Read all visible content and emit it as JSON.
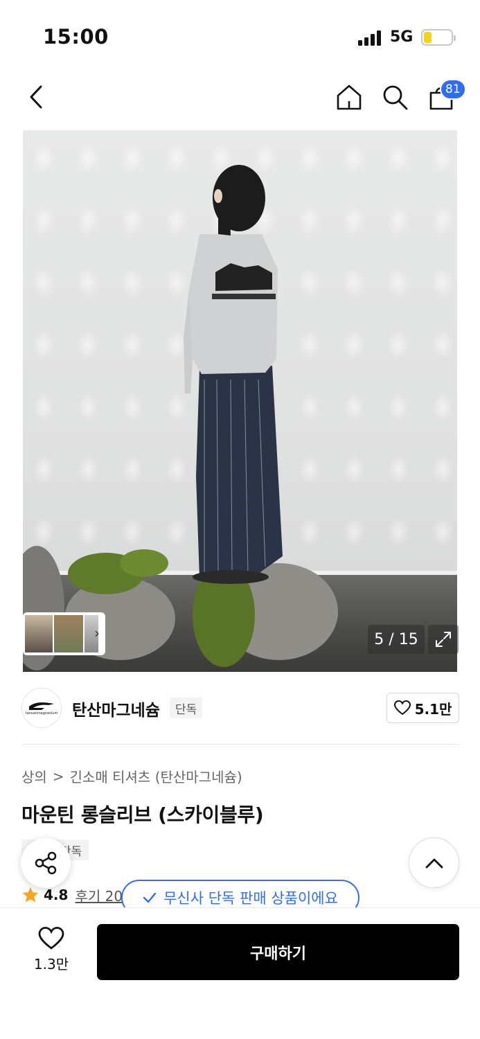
{
  "status_bar": {
    "time": "15:00",
    "network": "5G"
  },
  "nav": {
    "back_icon": "chevron-left-icon",
    "home_icon": "home-icon",
    "search_icon": "search-icon",
    "cart_icon": "shopping-bag-icon",
    "cart_count": "81"
  },
  "gallery": {
    "page_indicator": "5 / 15",
    "expand_icon": "expand-icon"
  },
  "brand": {
    "name": "탄산마그네슘",
    "logo_text": "tansanmagnesium",
    "badge": "단독",
    "like_count": "5.1만"
  },
  "breadcrumb": {
    "category": "상의",
    "separator": ">",
    "subcategory": "긴소매 티셔츠 (탄산마그네슘)"
  },
  "product": {
    "title": "마운틴 롱슬리브 (스카이블루)",
    "tag": "단독",
    "rating": "4.8",
    "review_link": "후기 20"
  },
  "toast": {
    "message": "무신사 단독 판매 상품이에요"
  },
  "bottom_bar": {
    "wish_count": "1.3만",
    "buy_label": "구매하기"
  },
  "colors": {
    "accent": "#2f6df6",
    "star": "#f5a623",
    "buy_button": "#000000"
  }
}
